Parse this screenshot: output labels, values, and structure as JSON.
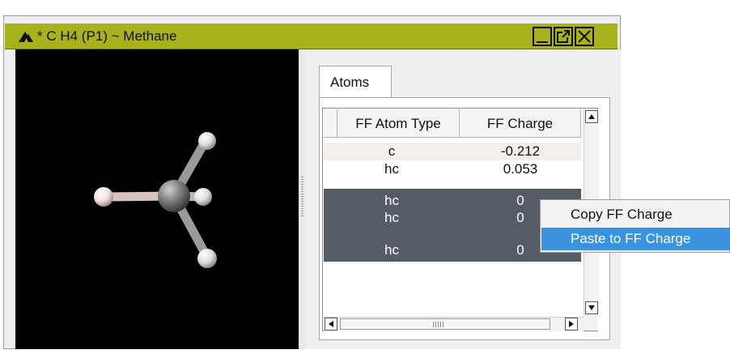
{
  "window": {
    "title": "* C H4  (P1) ~  Methane",
    "accent_color": "#a8b21c",
    "title_icons": [
      "app-logo-icon",
      "minimize-icon",
      "popout-icon",
      "close-icon"
    ]
  },
  "tabs": [
    {
      "label": "Atoms",
      "selected": true
    }
  ],
  "table": {
    "columns": [
      "FF Atom Type",
      "FF Charge"
    ],
    "rows": [
      {
        "atom_type": "c",
        "charge": "-0.212",
        "selected": false
      },
      {
        "atom_type": "hc",
        "charge": "0.053",
        "selected": false
      },
      {
        "atom_type": "hc",
        "charge": "0",
        "selected": true
      },
      {
        "atom_type": "hc",
        "charge": "0",
        "selected": true
      },
      {
        "atom_type": "hc",
        "charge": "0",
        "selected": true
      }
    ],
    "selection_color": "#565c66"
  },
  "context_menu": {
    "items": [
      {
        "label": "Copy FF Charge",
        "highlighted": false
      },
      {
        "label": "Paste to FF Charge",
        "highlighted": true
      }
    ],
    "highlight_color": "#3b93de"
  }
}
